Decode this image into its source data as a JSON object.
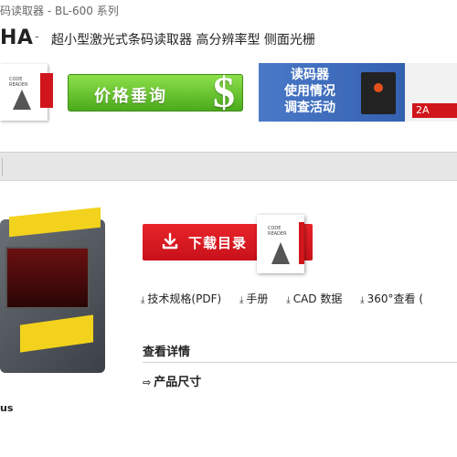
{
  "header": {
    "breadcrumb": "码读取器 - BL-600 系列",
    "model": "HA",
    "separator": "-",
    "subtitle": "超小型激光式条码读取器 高分辨率型 侧面光栅"
  },
  "banners": {
    "price_label": "价格垂询",
    "price_symbol": "$",
    "survey_line1": "读码器",
    "survey_line2": "使用情况",
    "survey_line3": "调查活动",
    "survey_tag": "2A"
  },
  "catalog": {
    "cover_text_1": "CODE",
    "cover_text_2": "READER"
  },
  "actions": {
    "download_label": "下载目录"
  },
  "links": [
    {
      "icon": "download-icon",
      "label": "技术规格(PDF)"
    },
    {
      "icon": "download-icon",
      "label": "手册"
    },
    {
      "icon": "download-icon",
      "label": "CAD 数据"
    },
    {
      "icon": "download-icon",
      "label": "360°查看 ("
    }
  ],
  "details": {
    "title": "查看详情",
    "size_link": "产品尺寸"
  },
  "certification": "us",
  "colors": {
    "accent_red": "#d0161b",
    "price_green": "#4caa1c",
    "survey_blue": "#2c58a8"
  }
}
